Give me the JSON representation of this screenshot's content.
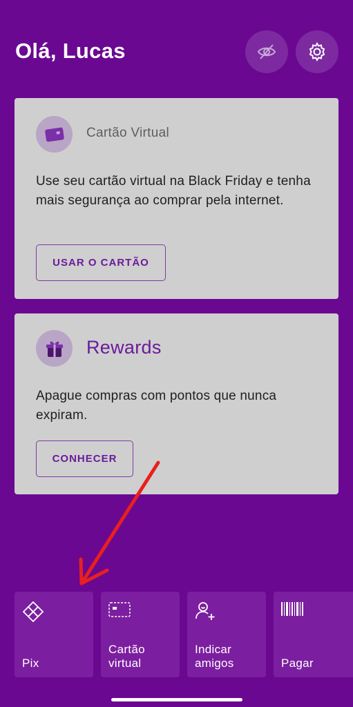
{
  "header": {
    "greeting": "Olá, Lucas",
    "hide_values_icon": "eye-off-icon",
    "settings_icon": "gear-icon"
  },
  "cards": {
    "virtual_card": {
      "icon": "credit-card-icon",
      "title": "Cartão Virtual",
      "text": "Use seu cartão virtual na Black Friday e tenha mais segurança ao comprar pela internet.",
      "button_label": "USAR O CARTÃO"
    },
    "rewards": {
      "icon": "gift-icon",
      "title": "Rewards",
      "text": "Apague compras com pontos que nunca expiram.",
      "button_label": "CONHECER"
    }
  },
  "shortcuts": {
    "pix": {
      "label": "Pix",
      "icon": "pix-icon"
    },
    "virtual_card": {
      "label": "Cartão\nvirtual",
      "icon": "card-outline-icon"
    },
    "refer_friends": {
      "label": "Indicar\namigos",
      "icon": "add-person-icon"
    },
    "pay": {
      "label": "Pagar",
      "icon": "barcode-icon"
    }
  },
  "colors": {
    "background": "#6a0891",
    "card": "#cfcfcf",
    "accent": "#6a1b9a",
    "tile": "#7c1ea0",
    "annotation_arrow": "#e8201f"
  }
}
